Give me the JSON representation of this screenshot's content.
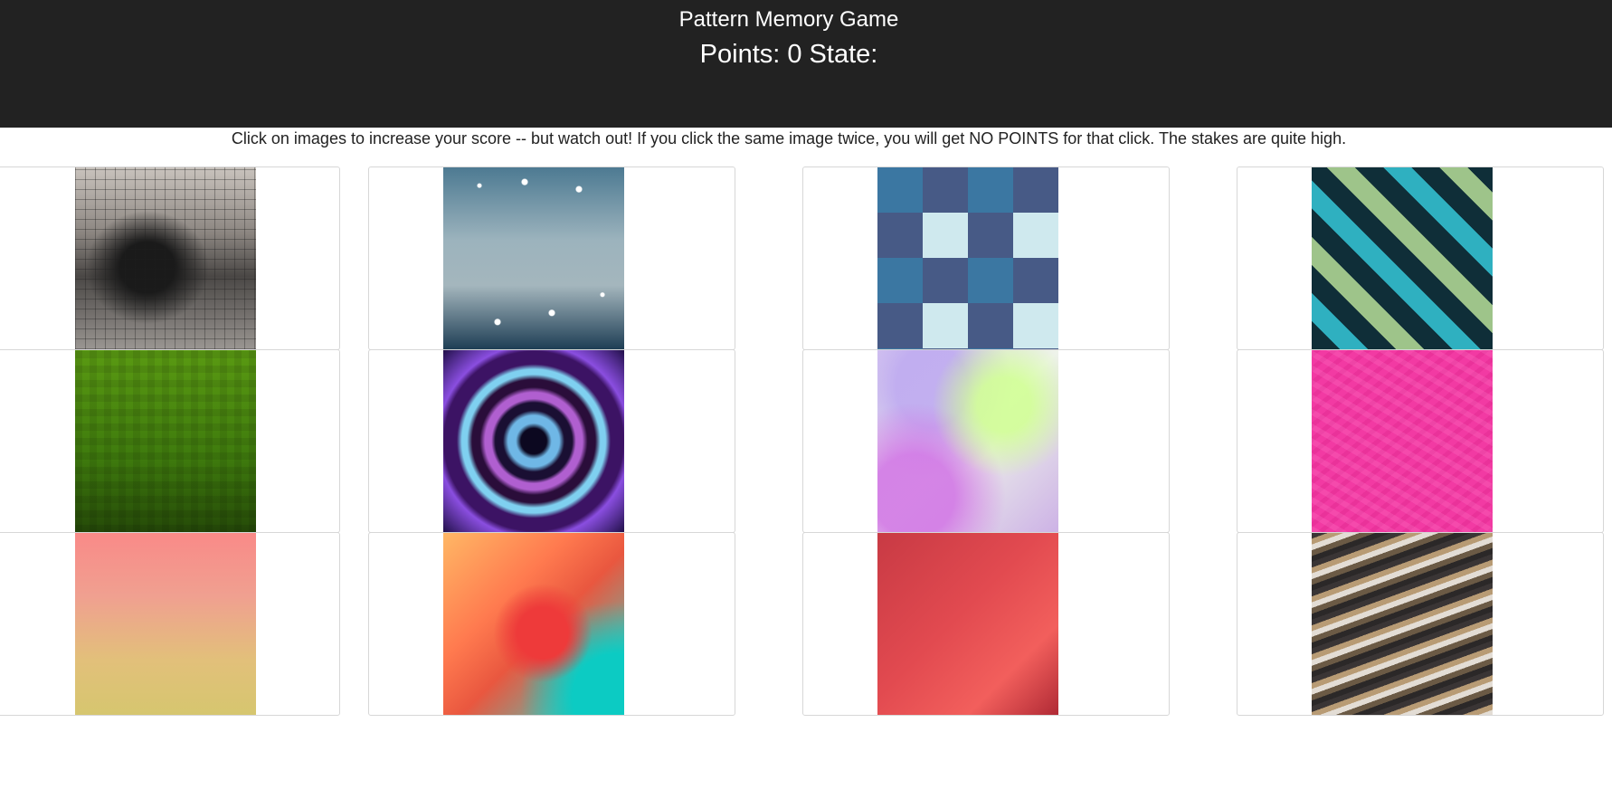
{
  "header": {
    "title": "Pattern Memory Game",
    "points_text": "Points: 0 State:"
  },
  "instructions": "Click on images to increase your score -- but watch out! If you click the same image twice, you will get NO POINTS for that click. The stakes are quite high.",
  "cards": [
    {
      "image": "cave-fractal-pattern",
      "clicked": false
    },
    {
      "image": "network-dots-pattern",
      "clicked": false
    },
    {
      "image": "denim-checker-pattern",
      "clicked": false
    },
    {
      "image": "diagonal-plaid-pattern",
      "clicked": false
    },
    {
      "image": "green-pixel-pattern",
      "clicked": false
    },
    {
      "image": "kaleidoscope-pattern",
      "clicked": false
    },
    {
      "image": "pastel-prism-pattern",
      "clicked": false
    },
    {
      "image": "pink-texture-pattern",
      "clicked": false
    },
    {
      "image": "peach-polygon-pattern",
      "clicked": false
    },
    {
      "image": "colorful-polygon-pattern",
      "clicked": false
    },
    {
      "image": "red-polygon-pattern",
      "clicked": false
    },
    {
      "image": "marble-stone-pattern",
      "clicked": false
    }
  ]
}
